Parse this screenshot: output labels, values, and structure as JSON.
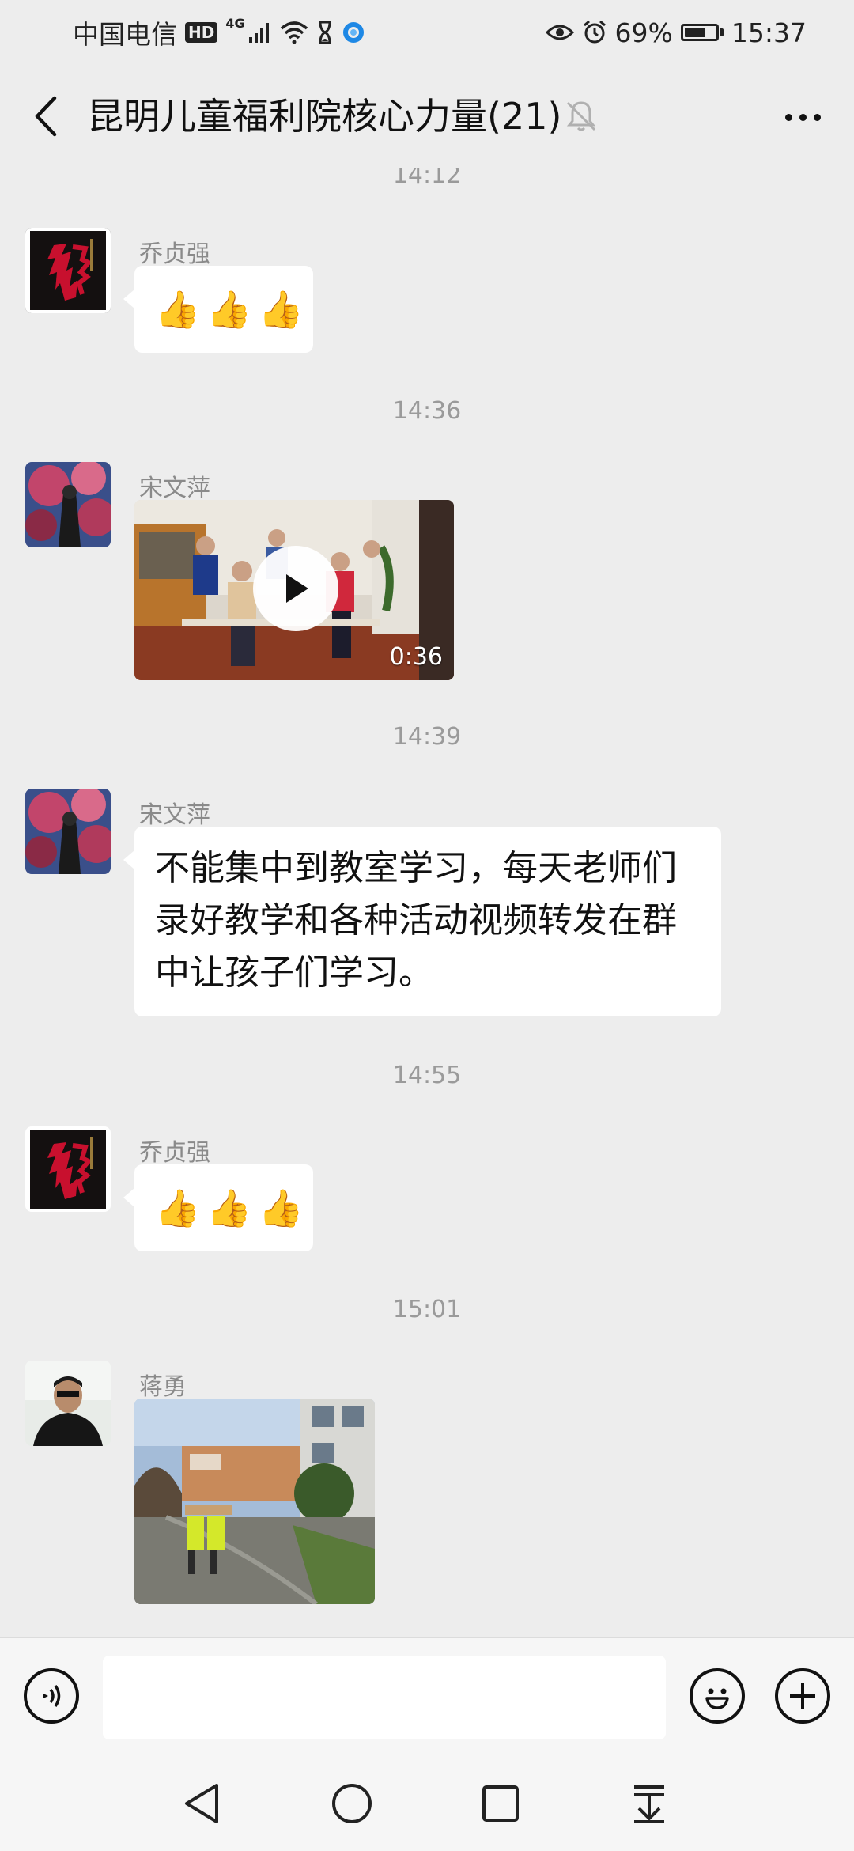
{
  "status_bar": {
    "carrier": "中国电信",
    "hd": "HD",
    "network": "4G",
    "battery_pct": "69%",
    "battery_level": 0.69,
    "time": "15:37"
  },
  "header": {
    "title": "昆明儿童福利院核心力量(21)",
    "muted": true
  },
  "messages": [
    {
      "type": "time",
      "text": "14:12"
    },
    {
      "type": "emoji",
      "sender": "乔贞强",
      "emoji": [
        "👍",
        "👍",
        "👍"
      ]
    },
    {
      "type": "time",
      "text": "14:36"
    },
    {
      "type": "video",
      "sender": "宋文萍",
      "duration": "0:36"
    },
    {
      "type": "time",
      "text": "14:39"
    },
    {
      "type": "text",
      "sender": "宋文萍",
      "lines": [
        "不能集中到教室学习，每天老师们",
        "录好教学和各种活动视频转发在群",
        "中让孩子们学习。"
      ]
    },
    {
      "type": "time",
      "text": "14:55"
    },
    {
      "type": "emoji",
      "sender": "乔贞强",
      "emoji": [
        "👍",
        "👍",
        "👍"
      ]
    },
    {
      "type": "time",
      "text": "15:01"
    },
    {
      "type": "image",
      "sender": "蒋勇"
    }
  ],
  "input": {
    "value": "",
    "placeholder": ""
  },
  "icons": {
    "back": "chevron-left-icon",
    "mute": "bell-off-icon",
    "more": "more-horizontal-icon",
    "voice": "voice-input-icon",
    "emoji": "smiley-face-icon",
    "plus": "add-circle-icon",
    "nav_back": "triangle-back-icon",
    "nav_home": "circle-home-icon",
    "nav_recents": "square-recents-icon",
    "nav_notifications": "pull-down-icon"
  },
  "colors": {
    "background": "#ededed",
    "bubble": "#ffffff",
    "time_text": "#9a9a9a",
    "sender_text": "#8a8a8a"
  }
}
